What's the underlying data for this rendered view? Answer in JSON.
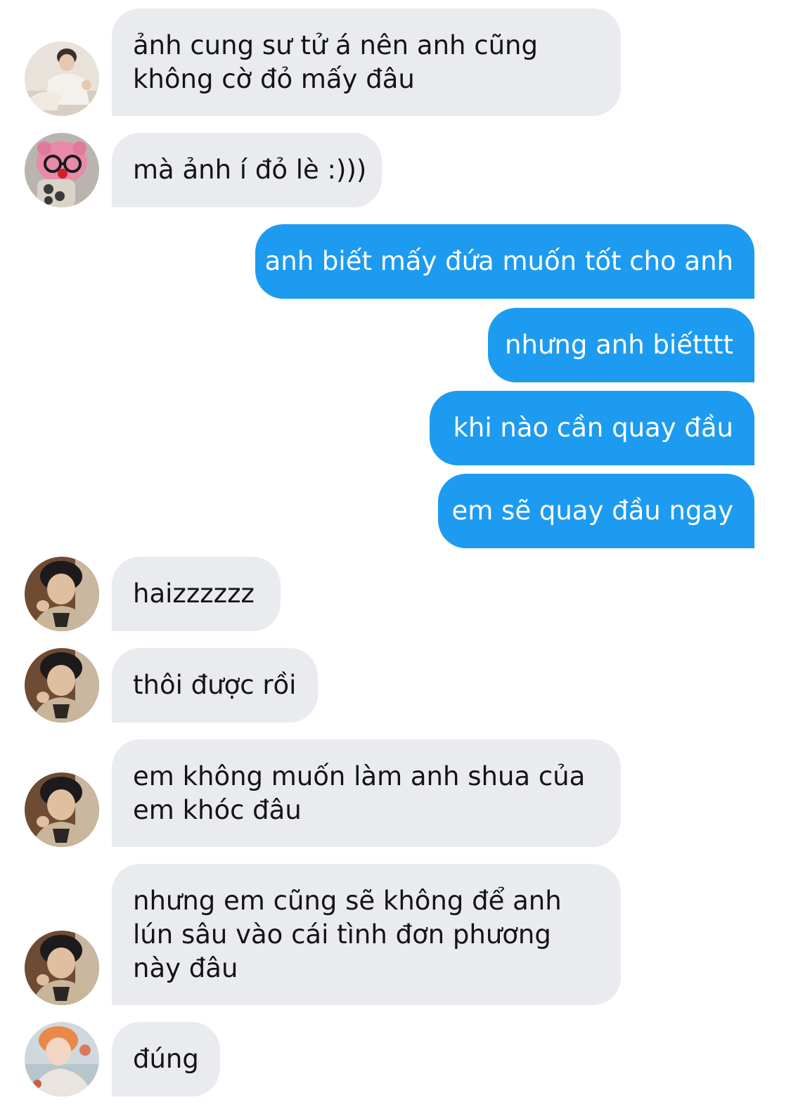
{
  "messages": [
    {
      "side": "in",
      "avatar": "person-white-shirt",
      "text": "ảnh cung sư tử á nên anh cũng không cờ đỏ mấy đâu"
    },
    {
      "side": "in",
      "avatar": "pink-plush-glasses",
      "text": "mà ảnh í đỏ lè :)))"
    },
    {
      "side": "out",
      "text": "anh biết mấy đứa muốn tốt cho anh"
    },
    {
      "side": "out",
      "text": "nhưng anh biếtttt"
    },
    {
      "side": "out",
      "text": "khi nào cần quay đầu"
    },
    {
      "side": "out",
      "text": "em sẽ quay đầu ngay"
    },
    {
      "side": "in",
      "avatar": "boy-dark-hair",
      "text": "haizzzzzz"
    },
    {
      "side": "in",
      "avatar": "boy-dark-hair",
      "text": "thôi được rồi"
    },
    {
      "side": "in",
      "avatar": "boy-dark-hair",
      "text": "em không muốn làm anh shua của em khóc đâu"
    },
    {
      "side": "in",
      "avatar": "boy-dark-hair",
      "text": "nhưng em cũng sẽ không để anh lún sâu vào cái tình đơn phương này đâu"
    },
    {
      "side": "in",
      "avatar": "boy-orange-hair",
      "text": "đúng"
    }
  ],
  "colors": {
    "incoming_bubble": "#e9ebef",
    "outgoing_bubble": "#1d9bf0",
    "incoming_text": "#141414",
    "outgoing_text": "#ffffff"
  }
}
